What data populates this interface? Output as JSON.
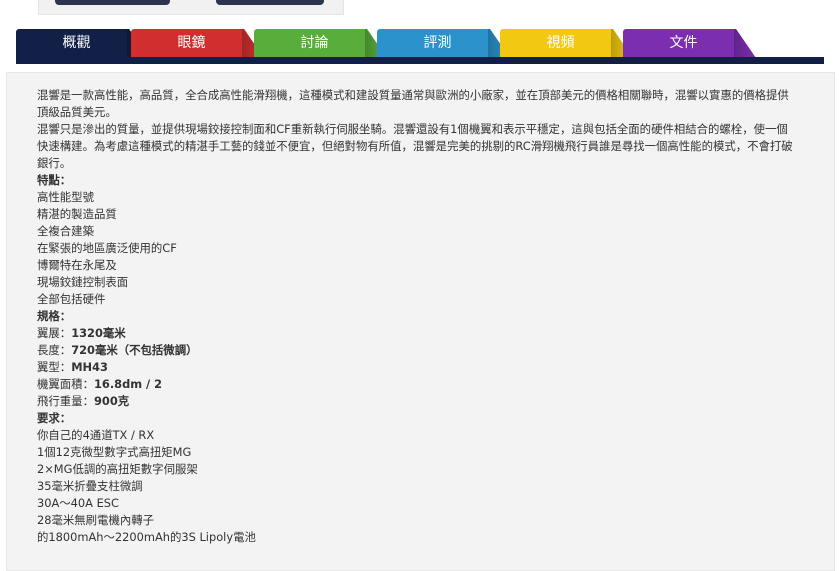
{
  "tabs": [
    {
      "label": "概觀",
      "color": "#121f47"
    },
    {
      "label": "眼鏡",
      "color": "#d12f2f"
    },
    {
      "label": "討論",
      "color": "#58ad3b"
    },
    {
      "label": "評測",
      "color": "#2b92cc"
    },
    {
      "label": "視頻",
      "color": "#f2c813"
    },
    {
      "label": "文件",
      "color": "#7b2eb0"
    }
  ],
  "intro": [
    "混響是一款高性能，高品質，全合成高性能滑翔機，這種模式和建設質量通常與歐洲的小廠家，並在頂部美元的價格相關聯時，混響以實惠的價格提供頂級品質美元。",
    "混響只是滲出的質量，並提供現場鉸接控制面和CF重新執行伺服坐騎。混響還設有1個機翼和表示平穩定，這與包括全面的硬件相結合的螺栓，使一個快速構建。為考慮這種模式的精湛手工藝的錢並不便宜，但絕對物有所值，混響是完美的挑剔的RC滑翔機飛行員誰是尋找一個高性能的模式，不會打破銀行。"
  ],
  "features": {
    "heading": "特點：",
    "items": [
      "高性能型號",
      "精湛的製造品質",
      "全複合建築",
      "在緊張的地區廣泛使用的CF",
      "博爾特在永尾及",
      "現場鉸鏈控制表面",
      "全部包括硬件"
    ]
  },
  "specs": {
    "heading": "規格：",
    "items": [
      {
        "label": "翼展：",
        "value": "1320毫米"
      },
      {
        "label": "長度：",
        "value": "720毫米（不包括微調）"
      },
      {
        "label": "翼型：",
        "value": "MH43"
      },
      {
        "label": "機翼面積：",
        "value": "16.8dm / 2"
      },
      {
        "label": "飛行重量：",
        "value": "900克"
      }
    ]
  },
  "requirements": {
    "heading": "要求：",
    "items": [
      "你自己的4通道TX / RX",
      "1個12克微型數字式高扭矩MG",
      "2×MG低調的高扭矩數字伺服架",
      "35毫米折疊支柱微調",
      "30A～40A ESC",
      "28毫米無刷電機內轉子",
      "的1800mAh～2200mAh的3S Lipoly電池"
    ]
  }
}
